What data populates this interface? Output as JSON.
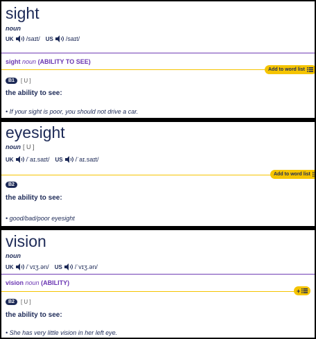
{
  "entries": [
    {
      "headword": "sight",
      "pos": "noun",
      "grammar": "",
      "uk_label": "UK",
      "uk_ipa": "/saɪt/",
      "us_label": "US",
      "us_ipa": "/saɪt/",
      "sense_word": "sight",
      "sense_pos": "noun",
      "sense_guide": "(ABILITY TO SEE)",
      "button_label": "Add to word list",
      "level": "B1",
      "level_grammar": "[ U ]",
      "definition": "the ability to see:",
      "example": "• If your sight is poor, you should not drive a car."
    },
    {
      "headword": "eyesight",
      "pos": "noun",
      "grammar": "[ U ]",
      "uk_label": "UK",
      "uk_ipa": "/ˈaɪ.saɪt/",
      "us_label": "US",
      "us_ipa": "/ˈaɪ.saɪt/",
      "button_label": "Add to word list",
      "level": "B2",
      "definition": "the ability to see:",
      "example": "• good/bad/poor eyesight"
    },
    {
      "headword": "vision",
      "pos": "noun",
      "grammar": "",
      "uk_label": "UK",
      "uk_ipa": "/ˈvɪʒ.ən/",
      "us_label": "US",
      "us_ipa": "/ˈvɪʒ.ən/",
      "sense_word": "vision",
      "sense_pos": "noun",
      "sense_guide": "(ABILITY)",
      "button_label": "+",
      "level": "B2",
      "level_grammar": "[ U ]",
      "definition": "the ability to see:",
      "example": "• She has very little vision in her left eye."
    }
  ],
  "icons": {
    "speaker": "speaker-icon",
    "list": "list-icon"
  },
  "colors": {
    "navy": "#1d2a57",
    "purple": "#6a35b2",
    "yellow": "#f5c400"
  }
}
